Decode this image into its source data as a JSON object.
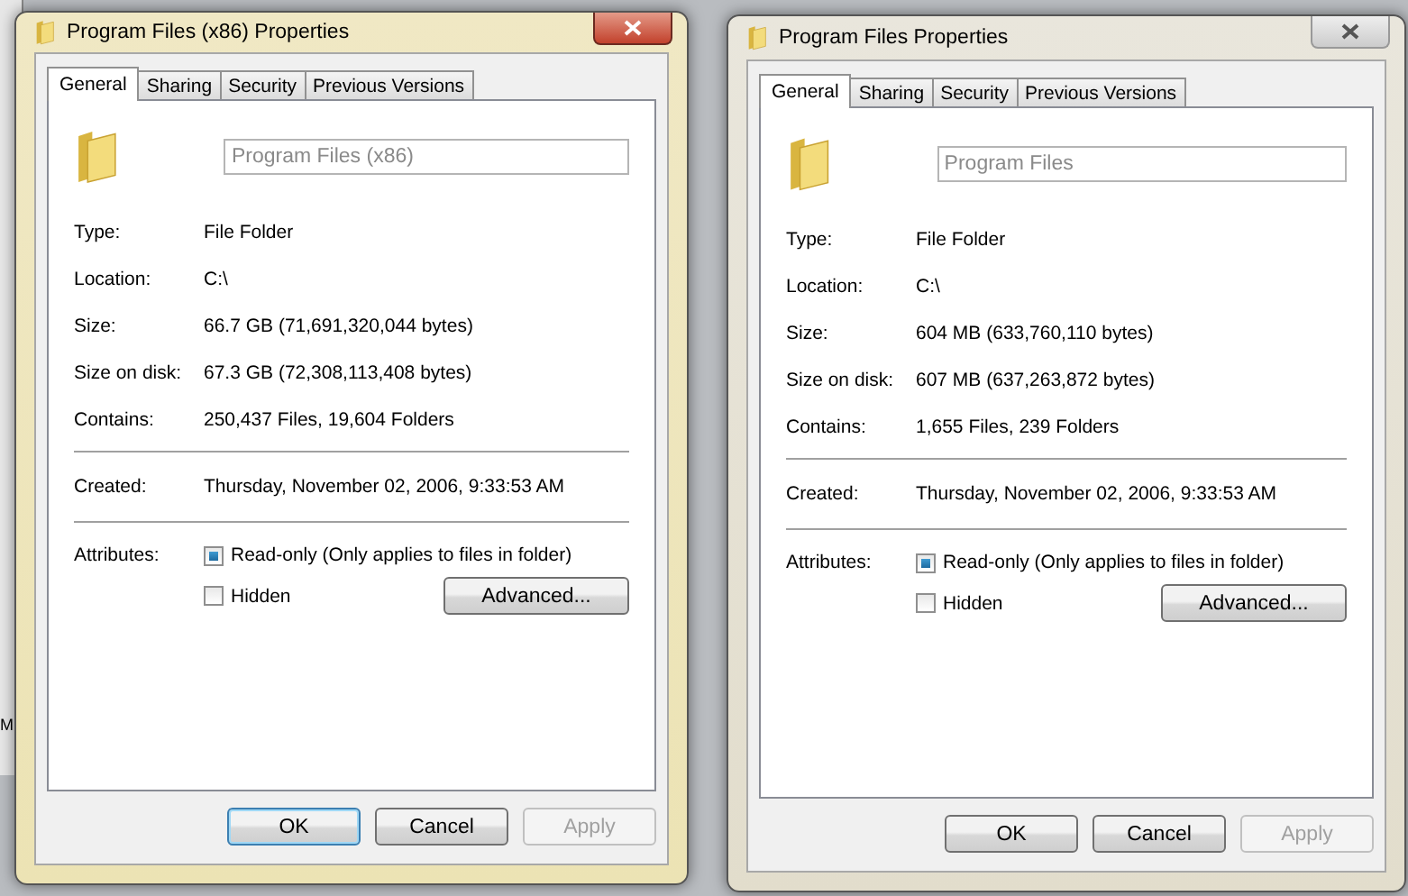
{
  "background_fragment": "M",
  "windows": [
    {
      "title": "Program Files (x86) Properties",
      "active": true,
      "tabs": [
        {
          "label": "General",
          "selected": true
        },
        {
          "label": "Sharing",
          "selected": false
        },
        {
          "label": "Security",
          "selected": false
        },
        {
          "label": "Previous Versions",
          "selected": false
        }
      ],
      "name_field": {
        "value": "Program Files (x86)",
        "disabled": true
      },
      "details": [
        {
          "label": "Type:",
          "value": "File Folder"
        },
        {
          "label": "Location:",
          "value": "C:\\"
        },
        {
          "label": "Size:",
          "value": "66.7 GB (71,691,320,044 bytes)"
        },
        {
          "label": "Size on disk:",
          "value": "67.3 GB (72,308,113,408 bytes)"
        },
        {
          "label": "Contains:",
          "value": "250,437 Files, 19,604 Folders"
        }
      ],
      "dates": [
        {
          "label": "Created:",
          "value": "Thursday, November 02, 2006, 9:33:53 AM"
        }
      ],
      "attributes": {
        "label": "Attributes:",
        "options": [
          {
            "label": "Read-only (Only applies to files in folder)",
            "checked": true
          },
          {
            "label": "Hidden",
            "checked": false
          }
        ],
        "advanced": "Advanced..."
      },
      "buttons": [
        {
          "label": "OK",
          "default": true,
          "disabled": false
        },
        {
          "label": "Cancel",
          "default": false,
          "disabled": false
        },
        {
          "label": "Apply",
          "default": false,
          "disabled": true
        }
      ]
    },
    {
      "title": "Program Files Properties",
      "active": false,
      "tabs": [
        {
          "label": "General",
          "selected": true
        },
        {
          "label": "Sharing",
          "selected": false
        },
        {
          "label": "Security",
          "selected": false
        },
        {
          "label": "Previous Versions",
          "selected": false
        }
      ],
      "name_field": {
        "value": "Program Files",
        "disabled": true
      },
      "details": [
        {
          "label": "Type:",
          "value": "File Folder"
        },
        {
          "label": "Location:",
          "value": "C:\\"
        },
        {
          "label": "Size:",
          "value": "604 MB (633,760,110 bytes)"
        },
        {
          "label": "Size on disk:",
          "value": "607 MB (637,263,872 bytes)"
        },
        {
          "label": "Contains:",
          "value": "1,655 Files, 239 Folders"
        }
      ],
      "dates": [
        {
          "label": "Created:",
          "value": "Thursday, November 02, 2006, 9:33:53 AM"
        }
      ],
      "attributes": {
        "label": "Attributes:",
        "options": [
          {
            "label": "Read-only (Only applies to files in folder)",
            "checked": true
          },
          {
            "label": "Hidden",
            "checked": false
          }
        ],
        "advanced": "Advanced..."
      },
      "buttons": [
        {
          "label": "OK",
          "default": false,
          "disabled": false
        },
        {
          "label": "Cancel",
          "default": false,
          "disabled": false
        },
        {
          "label": "Apply",
          "default": false,
          "disabled": true
        }
      ]
    }
  ]
}
